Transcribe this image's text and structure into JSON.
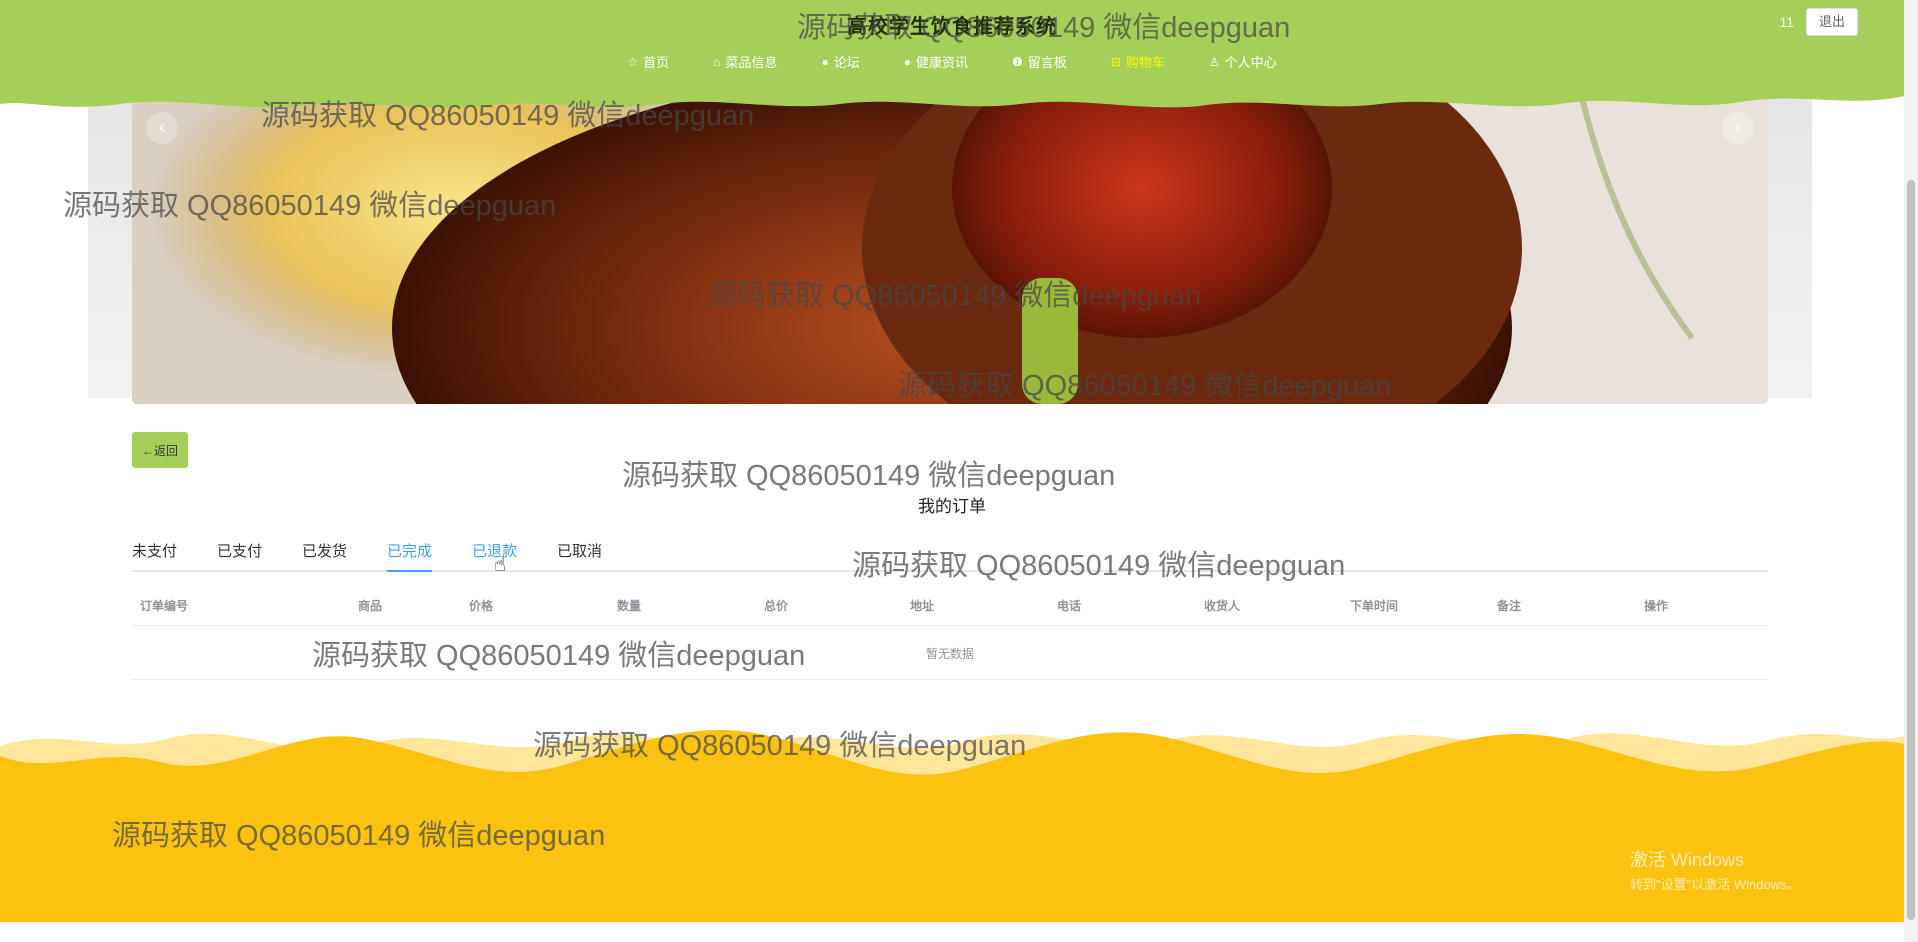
{
  "header": {
    "site_title": "高校学生饮食推荐系统",
    "user_name": "11",
    "logout_label": "退出",
    "nav": [
      {
        "label": "首页",
        "icon": "star-icon",
        "glyph": "☆",
        "active": false
      },
      {
        "label": "菜品信息",
        "icon": "bag-icon",
        "glyph": "⌂",
        "active": false
      },
      {
        "label": "论坛",
        "icon": "dot-icon",
        "glyph": "●",
        "active": false
      },
      {
        "label": "健康资讯",
        "icon": "dot-icon",
        "glyph": "●",
        "active": false
      },
      {
        "label": "留言板",
        "icon": "info-icon",
        "glyph": "❶",
        "active": false
      },
      {
        "label": "购物车",
        "icon": "cart-icon",
        "glyph": "⊟",
        "active": true
      },
      {
        "label": "个人中心",
        "icon": "user-icon",
        "glyph": "♙",
        "active": false
      }
    ]
  },
  "carousel": {
    "prev": "‹",
    "next": "›"
  },
  "back_label": "←返回",
  "page_title": "我的订单",
  "tabs": [
    {
      "label": "未支付"
    },
    {
      "label": "已支付"
    },
    {
      "label": "已发货"
    },
    {
      "label": "已完成"
    },
    {
      "label": "已退款"
    },
    {
      "label": "已取消"
    }
  ],
  "table": {
    "columns": [
      "订单编号",
      "商品",
      "价格",
      "数量",
      "总价",
      "地址",
      "电话",
      "收货人",
      "下单时间",
      "备注",
      "操作"
    ],
    "empty_text": "暂无数据"
  },
  "watermark_text": "源码获取 QQ86050149 微信deepguan",
  "windows_activation": {
    "line1": "激活 Windows",
    "line2": "转到\"设置\"以激活 Windows。"
  },
  "colors": {
    "header_green": "#a5cf58",
    "footer_yellow": "#fbc210",
    "active_nav": "#fff700",
    "tab_active": "#409eff"
  }
}
